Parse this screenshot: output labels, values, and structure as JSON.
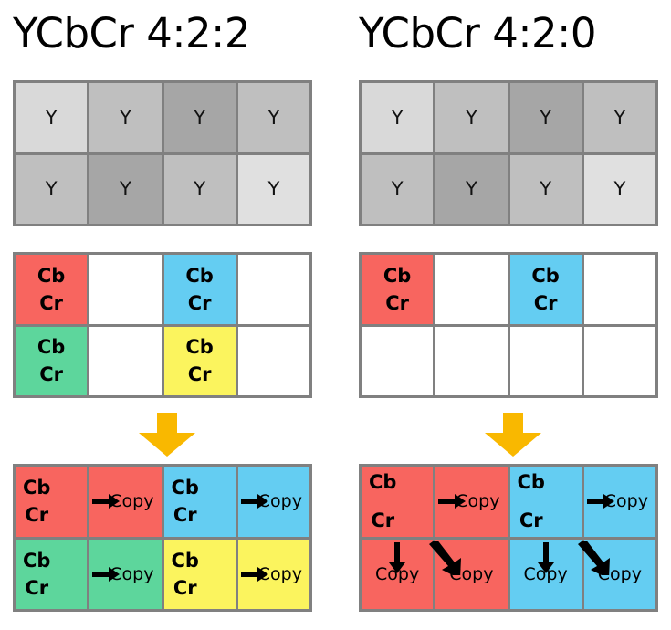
{
  "panels": [
    {
      "id": "422",
      "title": "YCbCr 4:2:2",
      "luma": {
        "label": "Y",
        "rows": [
          [
            {
              "label": "Y",
              "color": "#d9d9d9"
            },
            {
              "label": "Y",
              "color": "#bfbfbf"
            },
            {
              "label": "Y",
              "color": "#a6a6a6"
            },
            {
              "label": "Y",
              "color": "#bfbfbf"
            }
          ],
          [
            {
              "label": "Y",
              "color": "#bfbfbf"
            },
            {
              "label": "Y",
              "color": "#a6a6a6"
            },
            {
              "label": "Y",
              "color": "#bfbfbf"
            },
            {
              "label": "Y",
              "color": "#e0e0e0"
            }
          ]
        ]
      },
      "chroma": {
        "cb_label": "Cb",
        "cr_label": "Cr",
        "rows": [
          [
            {
              "filled": true,
              "color": "#f8655f",
              "cb": "Cb",
              "cr": "Cr"
            },
            {
              "filled": false,
              "color": "#ffffff"
            },
            {
              "filled": true,
              "color": "#64cdf2",
              "cb": "Cb",
              "cr": "Cr"
            },
            {
              "filled": false,
              "color": "#ffffff"
            }
          ],
          [
            {
              "filled": true,
              "color": "#5dd69c",
              "cb": "Cb",
              "cr": "Cr"
            },
            {
              "filled": false,
              "color": "#ffffff"
            },
            {
              "filled": true,
              "color": "#fbf45e",
              "cb": "Cb",
              "cr": "Cr"
            },
            {
              "filled": false,
              "color": "#ffffff"
            }
          ]
        ]
      },
      "arrow": {
        "name": "down-arrow",
        "color": "#f9b800"
      },
      "result": {
        "copy_label": "Copy",
        "rows": [
          [
            {
              "color": "#f8655f",
              "kind": "source",
              "cb": "Cb",
              "cr": "Cr"
            },
            {
              "color": "#f8655f",
              "kind": "copy-right",
              "label": "Copy"
            },
            {
              "color": "#64cdf2",
              "kind": "source",
              "cb": "Cb",
              "cr": "Cr"
            },
            {
              "color": "#64cdf2",
              "kind": "copy-right",
              "label": "Copy"
            }
          ],
          [
            {
              "color": "#5dd69c",
              "kind": "source",
              "cb": "Cb",
              "cr": "Cr"
            },
            {
              "color": "#5dd69c",
              "kind": "copy-right",
              "label": "Copy"
            },
            {
              "color": "#fbf45e",
              "kind": "source",
              "cb": "Cb",
              "cr": "Cr"
            },
            {
              "color": "#fbf45e",
              "kind": "copy-right",
              "label": "Copy"
            }
          ]
        ]
      }
    },
    {
      "id": "420",
      "title": "YCbCr 4:2:0",
      "luma": {
        "label": "Y",
        "rows": [
          [
            {
              "label": "Y",
              "color": "#d9d9d9"
            },
            {
              "label": "Y",
              "color": "#bfbfbf"
            },
            {
              "label": "Y",
              "color": "#a6a6a6"
            },
            {
              "label": "Y",
              "color": "#bfbfbf"
            }
          ],
          [
            {
              "label": "Y",
              "color": "#bfbfbf"
            },
            {
              "label": "Y",
              "color": "#a6a6a6"
            },
            {
              "label": "Y",
              "color": "#bfbfbf"
            },
            {
              "label": "Y",
              "color": "#e0e0e0"
            }
          ]
        ]
      },
      "chroma": {
        "cb_label": "Cb",
        "cr_label": "Cr",
        "rows": [
          [
            {
              "filled": true,
              "color": "#f8655f",
              "cb": "Cb",
              "cr": "Cr"
            },
            {
              "filled": false,
              "color": "#ffffff"
            },
            {
              "filled": true,
              "color": "#64cdf2",
              "cb": "Cb",
              "cr": "Cr"
            },
            {
              "filled": false,
              "color": "#ffffff"
            }
          ],
          [
            {
              "filled": false,
              "color": "#ffffff"
            },
            {
              "filled": false,
              "color": "#ffffff"
            },
            {
              "filled": false,
              "color": "#ffffff"
            },
            {
              "filled": false,
              "color": "#ffffff"
            }
          ]
        ]
      },
      "arrow": {
        "name": "down-arrow",
        "color": "#f9b800"
      },
      "result": {
        "copy_label": "Copy",
        "rows": [
          [
            {
              "color": "#f8655f",
              "kind": "source",
              "cb": "Cb",
              "cr": "Cr"
            },
            {
              "color": "#f8655f",
              "kind": "copy-right",
              "label": "Copy"
            },
            {
              "color": "#64cdf2",
              "kind": "source",
              "cb": "Cb",
              "cr": "Cr"
            },
            {
              "color": "#64cdf2",
              "kind": "copy-right",
              "label": "Copy"
            }
          ],
          [
            {
              "color": "#f8655f",
              "kind": "copy-down",
              "label": "Copy"
            },
            {
              "color": "#f8655f",
              "kind": "copy-diag",
              "label": "Copy"
            },
            {
              "color": "#64cdf2",
              "kind": "copy-down",
              "label": "Copy"
            },
            {
              "color": "#64cdf2",
              "kind": "copy-diag",
              "label": "Copy"
            }
          ]
        ]
      }
    }
  ]
}
